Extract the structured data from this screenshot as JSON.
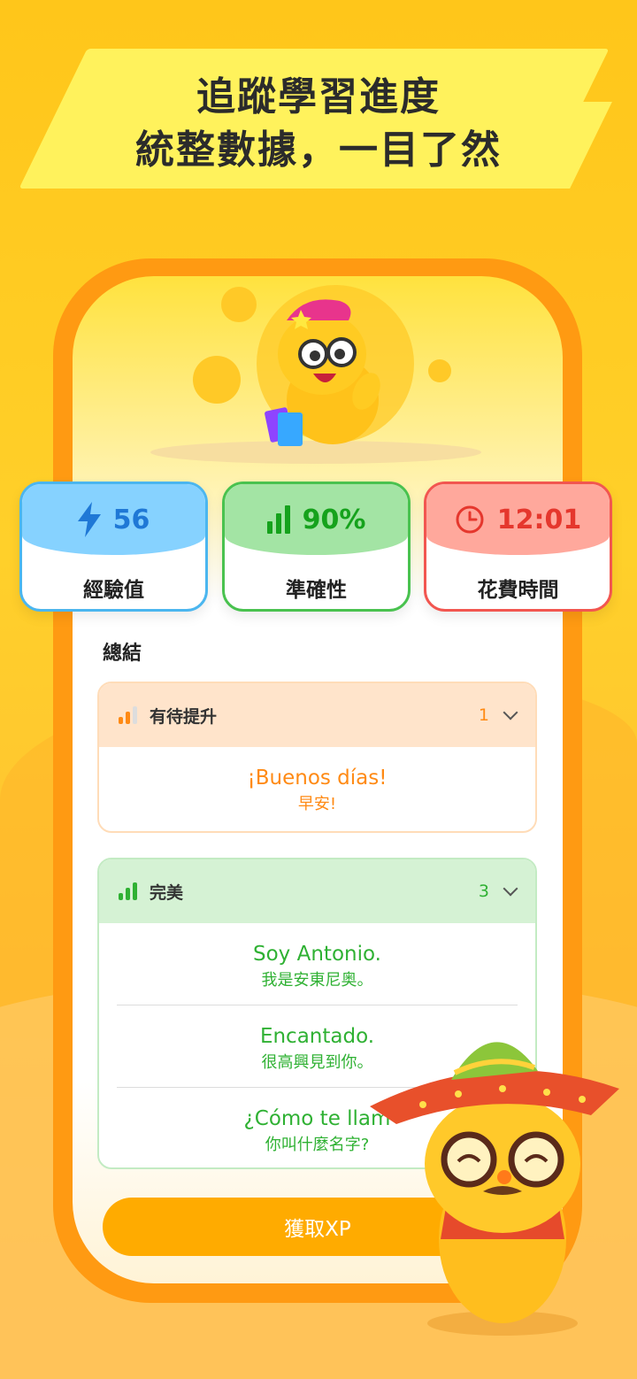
{
  "headline": {
    "line1": "追蹤學習進度",
    "line2": "統整數據，一目了然"
  },
  "stats": {
    "xp": {
      "value": "56",
      "label": "經驗值",
      "icon": "lightning-icon"
    },
    "accuracy": {
      "value": "90%",
      "label": "準確性",
      "icon": "signal-bars-icon"
    },
    "time": {
      "value": "12:01",
      "label": "花費時間",
      "icon": "clock-icon"
    }
  },
  "summary": {
    "title": "總結",
    "groups": [
      {
        "name": "有待提升",
        "count": "1",
        "entries": [
          {
            "es": "¡Buenos días!",
            "zh": "早安!"
          }
        ]
      },
      {
        "name": "完美",
        "count": "3",
        "entries": [
          {
            "es": "Soy Antonio.",
            "zh": "我是安東尼奥。"
          },
          {
            "es": "Encantado.",
            "zh": "很高興見到你。"
          },
          {
            "es": "¿Cómo te llam",
            "zh": "你叫什麼名字?"
          }
        ]
      }
    ]
  },
  "cta": {
    "label": "獲取XP"
  },
  "colors": {
    "accent": "#ff9a12",
    "xp": "#1f78d6",
    "accuracy": "#15a21c",
    "time": "#e5372d"
  }
}
